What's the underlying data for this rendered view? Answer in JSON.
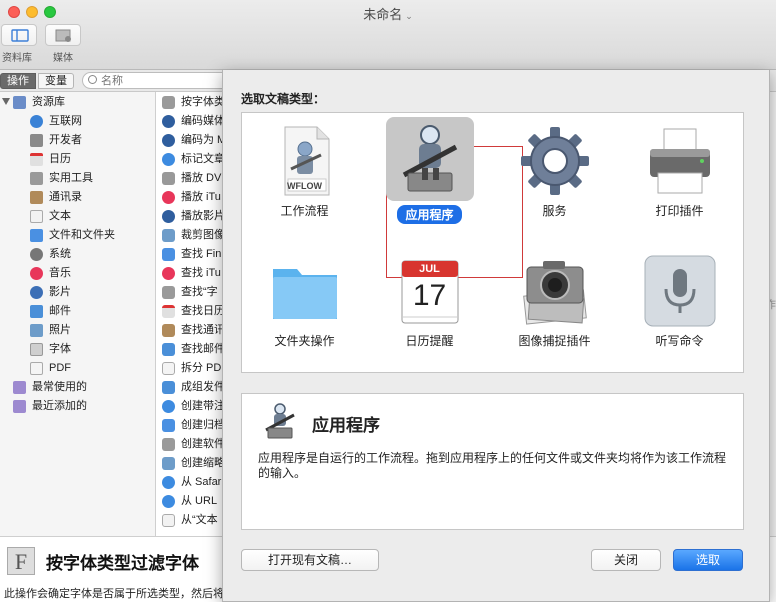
{
  "window": {
    "title": "未命名"
  },
  "toolbar": {
    "library_label": "资料库",
    "media_label": "媒体"
  },
  "subbar": {
    "actions_tab": "操作",
    "variables_tab": "变量",
    "search_placeholder": "名称"
  },
  "library": {
    "root": "资源库",
    "items": [
      "互联网",
      "开发者",
      "日历",
      "实用工具",
      "通讯录",
      "文本",
      "文件和文件夹",
      "系统",
      "音乐",
      "影片",
      "邮件",
      "照片",
      "字体",
      "PDF"
    ],
    "smart": [
      "最常使用的",
      "最近添加的"
    ]
  },
  "actions": {
    "items": [
      "按字体类",
      "编码媒体",
      "编码为 M",
      "标记文章",
      "播放 DV",
      "播放 iTu",
      "播放影片",
      "裁剪图像",
      "查找 Fin",
      "查找 iTu",
      "查找“字",
      "查找日历",
      "查找通讯",
      "查找邮件",
      "拆分 PD",
      "成组发件",
      "创建带注",
      "创建归档",
      "创建软件",
      "创建缩略",
      "从 Safari",
      "从 URL",
      "从“文本"
    ]
  },
  "description": {
    "title": "按字体类型过滤字体",
    "text": "此操作会确定字体是否属于所选类型，然后将匹配字体的列表传递至下"
  },
  "sheet": {
    "heading": "选取文稿类型：",
    "types": [
      {
        "label": "工作流程",
        "icon": "workflow-file-icon",
        "badge": "WFLOW"
      },
      {
        "label": "应用程序",
        "icon": "automator-robot-icon",
        "selected": true
      },
      {
        "label": "服务",
        "icon": "gear-icon"
      },
      {
        "label": "打印插件",
        "icon": "printer-icon"
      },
      {
        "label": "文件夹操作",
        "icon": "folder-icon"
      },
      {
        "label": "日历提醒",
        "icon": "calendar-icon",
        "month": "JUL",
        "day": "17"
      },
      {
        "label": "图像捕捉插件",
        "icon": "camera-icon"
      },
      {
        "label": "听写命令",
        "icon": "microphone-icon"
      }
    ],
    "info_title": "应用程序",
    "info_text": "应用程序是自运行的工作流程。拖到应用程序上的任何文件或文件夹均将作为该工作流程的输入。",
    "buttons": {
      "open_existing": "打开现有文稿…",
      "close": "关闭",
      "choose": "选取"
    }
  },
  "colors": {
    "accent": "#1d6ee6",
    "selection_frame": "#d03a3a"
  }
}
